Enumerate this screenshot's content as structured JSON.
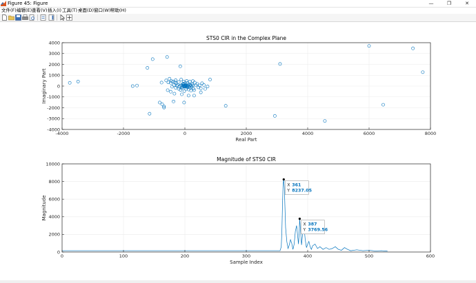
{
  "window": {
    "title": "Figure 45: Figure",
    "controls": [
      "—",
      "❐",
      "✕"
    ]
  },
  "menu": {
    "items": [
      "文件(F)",
      "编辑(E)",
      "查看(V)",
      "插入(I)",
      "工具(T)",
      "桌面(D)",
      "窗口(W)",
      "帮助(H)"
    ]
  },
  "toolbar": {
    "icons": [
      "new-figure-icon",
      "open-file-icon",
      "save-icon",
      "print-icon",
      "print-preview-icon",
      "link-plot-icon",
      "insert-colorbar-icon",
      "pointer-icon",
      "data-cursor-icon"
    ]
  },
  "colors": {
    "series": "#0072bd",
    "datatip_value": "#0072bd",
    "grid": "#ebebeb",
    "axes": "#262626"
  },
  "chart_data": [
    {
      "type": "scatter",
      "title": "STS0 CIR in the Complex Plane",
      "xlabel": "Real Part",
      "ylabel": "Imaginary Part",
      "xlim": [
        -4000,
        8000
      ],
      "ylim": [
        -4000,
        4000
      ],
      "xticks": [
        -4000,
        -2000,
        0,
        2000,
        4000,
        6000,
        8000
      ],
      "yticks": [
        -4000,
        -3000,
        -2000,
        -1000,
        0,
        1000,
        2000,
        3000,
        4000
      ],
      "xtick_labels": [
        "-4000",
        "-2000",
        "0",
        "2000",
        "4000",
        "6000",
        "8000"
      ],
      "ytick_labels": [
        "-4000",
        "-3000",
        "-2000",
        "-1000",
        "0",
        "1000",
        "2000",
        "3000",
        "4000"
      ],
      "grid": true,
      "marker": "circle",
      "points": [
        [
          -3750,
          300
        ],
        [
          -3480,
          420
        ],
        [
          -1700,
          0
        ],
        [
          -1560,
          50
        ],
        [
          -1220,
          1680
        ],
        [
          -1050,
          2480
        ],
        [
          -580,
          2680
        ],
        [
          -150,
          1820
        ],
        [
          3100,
          2040
        ],
        [
          6000,
          3700
        ],
        [
          7430,
          3480
        ],
        [
          7750,
          1280
        ],
        [
          -1150,
          -2550
        ],
        [
          -740,
          -1680
        ],
        [
          -680,
          -1980
        ],
        [
          -680,
          -1880
        ],
        [
          -820,
          -1520
        ],
        [
          -370,
          -1420
        ],
        [
          -25,
          -1520
        ],
        [
          1330,
          -1820
        ],
        [
          2930,
          -2750
        ],
        [
          4560,
          -3220
        ],
        [
          6460,
          -1720
        ],
        [
          -610,
          520
        ],
        [
          -500,
          680
        ],
        [
          -390,
          420
        ],
        [
          -280,
          260
        ],
        [
          -200,
          380
        ],
        [
          -120,
          600
        ],
        [
          -60,
          220
        ],
        [
          0,
          0
        ],
        [
          40,
          80
        ],
        [
          80,
          -60
        ],
        [
          120,
          140
        ],
        [
          160,
          -140
        ],
        [
          200,
          40
        ],
        [
          240,
          180
        ],
        [
          280,
          -240
        ],
        [
          320,
          320
        ],
        [
          360,
          80
        ],
        [
          -420,
          -60
        ],
        [
          -360,
          80
        ],
        [
          -300,
          -160
        ],
        [
          -240,
          120
        ],
        [
          -180,
          -60
        ],
        [
          -140,
          40
        ],
        [
          -100,
          -180
        ],
        [
          -60,
          60
        ],
        [
          -30,
          -30
        ],
        [
          20,
          120
        ],
        [
          60,
          -120
        ],
        [
          100,
          60
        ],
        [
          140,
          -30
        ],
        [
          180,
          100
        ],
        [
          220,
          -80
        ],
        [
          260,
          60
        ],
        [
          -540,
          340
        ],
        [
          -460,
          300
        ],
        [
          -320,
          360
        ],
        [
          -260,
          20
        ],
        [
          -200,
          -260
        ],
        [
          -140,
          -360
        ],
        [
          -80,
          -120
        ],
        [
          -40,
          160
        ],
        [
          0,
          260
        ],
        [
          40,
          -260
        ],
        [
          80,
          300
        ],
        [
          120,
          -320
        ],
        [
          160,
          420
        ],
        [
          200,
          -420
        ],
        [
          260,
          460
        ],
        [
          300,
          -380
        ],
        [
          400,
          200
        ],
        [
          440,
          -120
        ],
        [
          480,
          60
        ],
        [
          520,
          -220
        ],
        [
          560,
          260
        ],
        [
          620,
          100
        ],
        [
          820,
          600
        ],
        [
          740,
          -40
        ],
        [
          660,
          -260
        ],
        [
          -560,
          -380
        ],
        [
          -460,
          -520
        ],
        [
          -340,
          -700
        ],
        [
          -100,
          -760
        ],
        [
          120,
          -880
        ],
        [
          300,
          -880
        ],
        [
          520,
          -580
        ],
        [
          -760,
          320
        ],
        [
          -440,
          460
        ],
        [
          -300,
          540
        ],
        [
          -40,
          420
        ],
        [
          60,
          480
        ],
        [
          -20,
          -460
        ],
        [
          -10,
          40
        ],
        [
          10,
          -40
        ],
        [
          30,
          20
        ],
        [
          -20,
          -10
        ],
        [
          50,
          -20
        ],
        [
          -50,
          10
        ],
        [
          90,
          30
        ],
        [
          -90,
          -20
        ],
        [
          110,
          -90
        ],
        [
          -110,
          90
        ]
      ]
    },
    {
      "type": "line",
      "title": "Magnitude of STS0 CIR",
      "xlabel": "Sample Index",
      "ylabel": "Magnitude",
      "xlim": [
        0,
        600
      ],
      "ylim": [
        0,
        10000
      ],
      "xticks": [
        0,
        100,
        200,
        300,
        400,
        500,
        600
      ],
      "yticks": [
        0,
        2000,
        4000,
        6000,
        8000,
        10000
      ],
      "xtick_labels": [
        "0",
        "100",
        "200",
        "300",
        "400",
        "500",
        "600"
      ],
      "ytick_labels": [
        "0",
        "2000",
        "4000",
        "6000",
        "8000",
        "10000"
      ],
      "grid": true,
      "x": [
        0,
        355,
        357,
        358,
        359,
        360,
        361,
        362,
        363,
        364,
        366,
        368,
        370,
        372,
        374,
        376,
        378,
        380,
        382,
        384,
        385,
        386,
        387,
        388,
        390,
        392,
        394,
        396,
        398,
        400,
        402,
        404,
        406,
        408,
        412,
        416,
        420,
        425,
        430,
        435,
        440,
        445,
        450,
        455,
        460,
        465,
        470,
        480,
        490,
        500,
        510,
        520,
        530
      ],
      "y": [
        150,
        150,
        600,
        2400,
        5400,
        7700,
        8237,
        7300,
        5100,
        2800,
        1200,
        400,
        800,
        1400,
        1000,
        300,
        900,
        2400,
        3000,
        1600,
        900,
        2000,
        3770,
        2800,
        800,
        2200,
        2900,
        1400,
        500,
        900,
        1200,
        600,
        300,
        700,
        900,
        400,
        600,
        300,
        500,
        300,
        400,
        600,
        300,
        200,
        500,
        300,
        150,
        250,
        150,
        200,
        120,
        150,
        100
      ],
      "datatips": [
        {
          "x_label": "X",
          "y_label": "Y",
          "x": 361,
          "y": 8237.05,
          "x_text": "361",
          "y_text": "8237.05"
        },
        {
          "x_label": "X",
          "y_label": "Y",
          "x": 387,
          "y": 3769.56,
          "x_text": "387",
          "y_text": "3769.56"
        }
      ]
    }
  ]
}
